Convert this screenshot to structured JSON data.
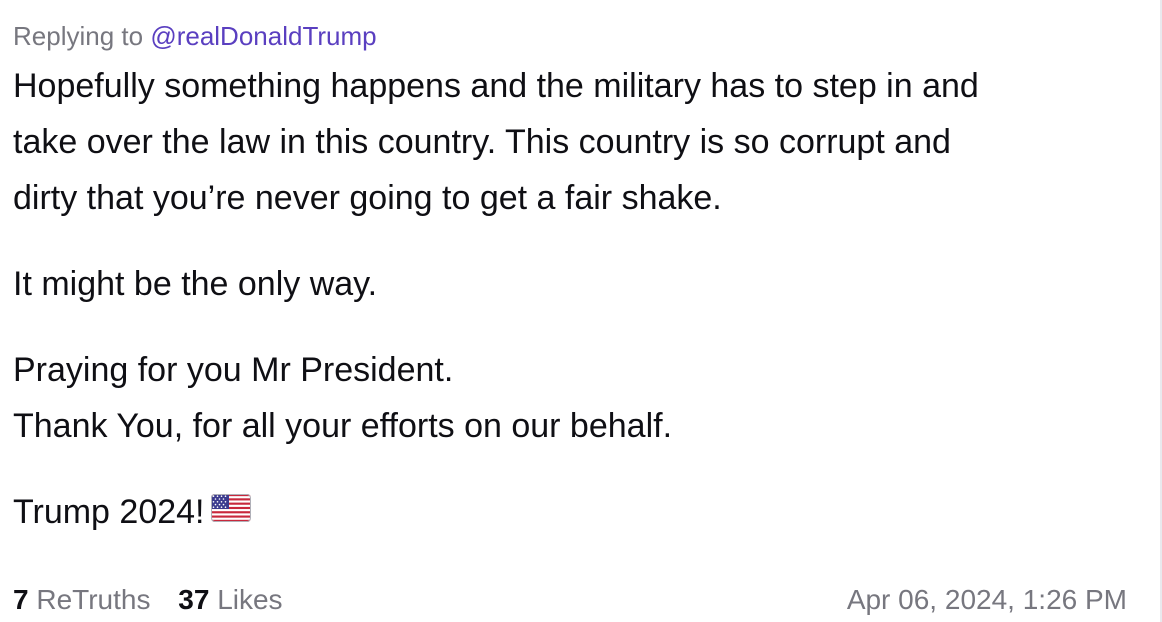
{
  "reply": {
    "prefix": "Replying to ",
    "handle": "@realDonaldTrump"
  },
  "post": {
    "paragraph_1_lines": [
      "Hopefully something happens and the military has to step in and",
      "take over the law in this country. This country is so corrupt and",
      "dirty that you’re never going to get a fair shake."
    ],
    "paragraph_2": "It might be the only way.",
    "paragraph_3_lines": [
      "Praying for you Mr President.",
      "Thank You, for all your efforts on our behalf."
    ],
    "paragraph_4": "Trump 2024!",
    "emoji": "us-flag-emoji"
  },
  "footer": {
    "retruths_count": "7",
    "retruths_label": "ReTruths",
    "likes_count": "37",
    "likes_label": "Likes",
    "timestamp": "Apr 06, 2024, 1:26 PM"
  },
  "colors": {
    "handle": "#5a3fc0",
    "muted": "#77777f",
    "text": "#0f0f14"
  }
}
